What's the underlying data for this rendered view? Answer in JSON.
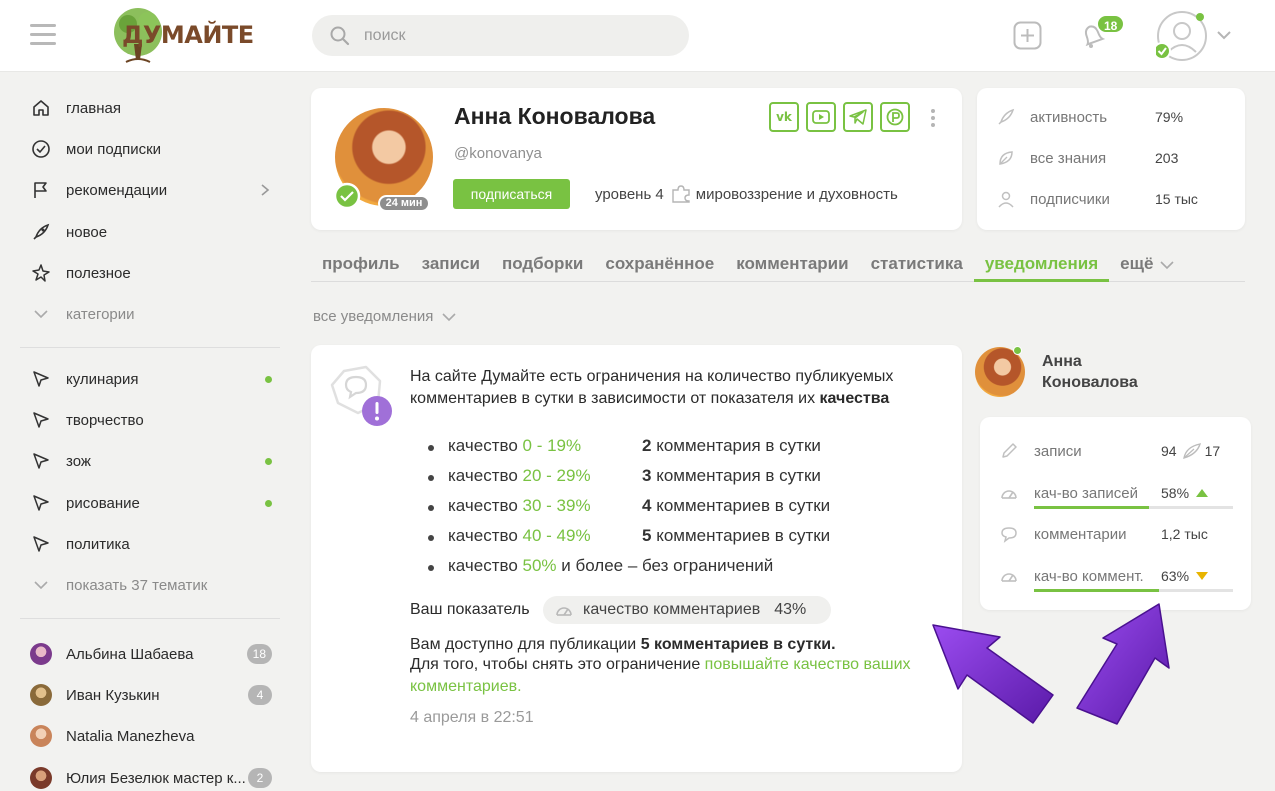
{
  "header": {
    "logo_text": "ДУМАЙТЕ",
    "search_placeholder": "поиск",
    "notifications_count": "18"
  },
  "sidebar": {
    "main": [
      {
        "label": "главная",
        "icon": "home-icon"
      },
      {
        "label": "мои подписки",
        "icon": "check-circle-icon"
      },
      {
        "label": "рекомендации",
        "icon": "flag-icon"
      },
      {
        "label": "новое",
        "icon": "rocket-icon"
      },
      {
        "label": "полезное",
        "icon": "star-icon"
      },
      {
        "label": "категории",
        "icon": "chevron-down-icon"
      }
    ],
    "topics": [
      {
        "label": "кулинария",
        "new": true
      },
      {
        "label": "творчество",
        "new": false
      },
      {
        "label": "зож",
        "new": true
      },
      {
        "label": "рисование",
        "new": true
      },
      {
        "label": "политика",
        "new": false
      }
    ],
    "show_more": "показать 37 тематик",
    "users": [
      {
        "name": "Альбина Шабаева",
        "count": "18",
        "color": "#7b3a8c"
      },
      {
        "name": "Иван Кузькин",
        "count": "4",
        "color": "#8a6a3a"
      },
      {
        "name": "Natalia Manezheva",
        "count": "",
        "color": "#c9845a"
      },
      {
        "name": "Юлия Безелюк мастер к...",
        "count": "2",
        "color": "#7a3a2a"
      }
    ]
  },
  "profile": {
    "name": "Анна Коновалова",
    "handle": "@konovanya",
    "subscribe_label": "подписаться",
    "level": "уровень 4",
    "topic": "мировоззрение и духовность",
    "online_time": "24 мин"
  },
  "stats": [
    {
      "label": "активность",
      "value": "79%"
    },
    {
      "label": "все знания",
      "value": "203"
    },
    {
      "label": "подписчики",
      "value": "15 тыс"
    }
  ],
  "tabs": [
    "профиль",
    "записи",
    "подборки",
    "сохранённое",
    "комментарии",
    "статистика",
    "уведомления",
    "ещё"
  ],
  "active_tab": "уведомления",
  "filter_label": "все уведомления",
  "notification": {
    "intro_line1": "На сайте Думайте есть ограничения на количество публикуемых",
    "intro_line2": "комментариев в сутки в зависимости от показателя их ",
    "intro_bold": "качества",
    "rules": [
      {
        "prefix": "качество ",
        "range": "0 - 19%",
        "suffix": "",
        "num": "2",
        "text": " комментария в сутки"
      },
      {
        "prefix": "качество ",
        "range": "20 - 29%",
        "suffix": "",
        "num": "3",
        "text": " комментария в сутки"
      },
      {
        "prefix": "качество ",
        "range": "30 - 39%",
        "suffix": "",
        "num": "4",
        "text": " комментариев в сутки"
      },
      {
        "prefix": "качество ",
        "range": "40 - 49%",
        "suffix": "",
        "num": "5",
        "text": " комментариев в сутки"
      },
      {
        "prefix": "качество ",
        "range": "50%",
        "suffix": " и более –",
        "num": "",
        "text": "без ограничений"
      }
    ],
    "your_indicator": "Ваш показатель",
    "indicator_label": "качество комментариев",
    "indicator_value": "43%",
    "available_text": "Вам доступно для публикации ",
    "available_bold": "5 комментариев в сутки.",
    "remove_text": "Для того, чтобы снять это ограничение ",
    "remove_link_1": "повышайте качество ваших",
    "remove_link_2": "комментариев.",
    "date": "4 апреля в 22:51"
  },
  "author": {
    "name_line1": "Анна",
    "name_line2": "Коновалова",
    "rows": [
      {
        "label": "записи",
        "value": "94",
        "extra": "17",
        "fill": null,
        "trend": null
      },
      {
        "label": "кач-во записей",
        "value": "58%",
        "extra": "",
        "fill": 0.58,
        "trend": "up"
      },
      {
        "label": "комментарии",
        "value": "1,2 тыс",
        "extra": "",
        "fill": null,
        "trend": null
      },
      {
        "label": "кач-во коммент.",
        "value": "63%",
        "extra": "",
        "fill": 0.63,
        "trend": "down"
      }
    ]
  },
  "colors": {
    "accent": "#79c242",
    "arrow": "#7b2fd6",
    "badge": "#a070d8",
    "trend_down": "#e8b400"
  }
}
